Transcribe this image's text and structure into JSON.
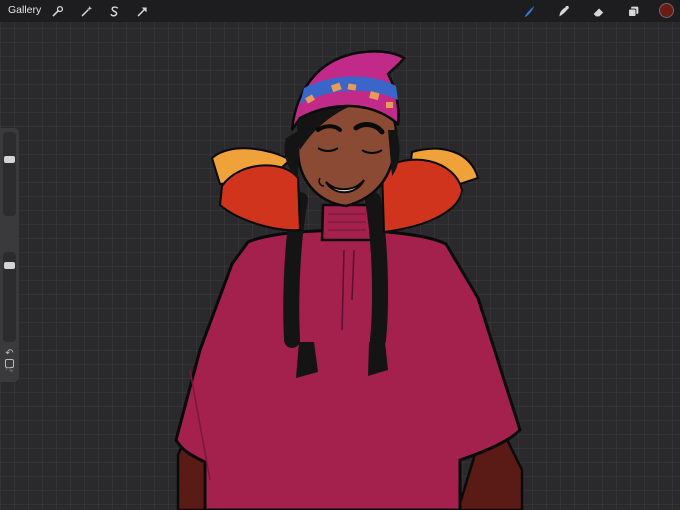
{
  "toolbar": {
    "gallery_label": "Gallery",
    "left_tools": [
      {
        "name": "actions",
        "icon": "wrench-icon"
      },
      {
        "name": "adjustments",
        "icon": "magic-wand-icon"
      },
      {
        "name": "selection",
        "icon": "selection-s-icon"
      },
      {
        "name": "transform",
        "icon": "arrow-cursor-icon"
      }
    ],
    "right_tools": [
      {
        "name": "brush",
        "icon": "brush-icon",
        "active": true
      },
      {
        "name": "smudge",
        "icon": "smudge-icon",
        "active": false
      },
      {
        "name": "eraser",
        "icon": "eraser-icon",
        "active": false
      },
      {
        "name": "layers",
        "icon": "layers-icon",
        "active": false
      }
    ],
    "current_color": "#6b1c14",
    "active_tool_color": "#3a7be0"
  },
  "sidebar": {
    "brush_size_level": 0.3,
    "brush_opacity_level": 0.1,
    "undo_icon": "undo-icon",
    "redo_icon": "redo-icon",
    "modify_icon": "square-modify-icon"
  },
  "artwork": {
    "colors": {
      "poncho": "#a3214c",
      "poncho_shadow": "#5a1a15",
      "skin": "#8a4a33",
      "hat_magenta": "#c22a8a",
      "hat_blue": "#3a66c9",
      "hat_orange": "#e89a58",
      "pompom_red": "#d0341c",
      "pompom_yellow": "#f0a23a",
      "hair": "#141414",
      "outline": "#0a0a0a"
    }
  }
}
